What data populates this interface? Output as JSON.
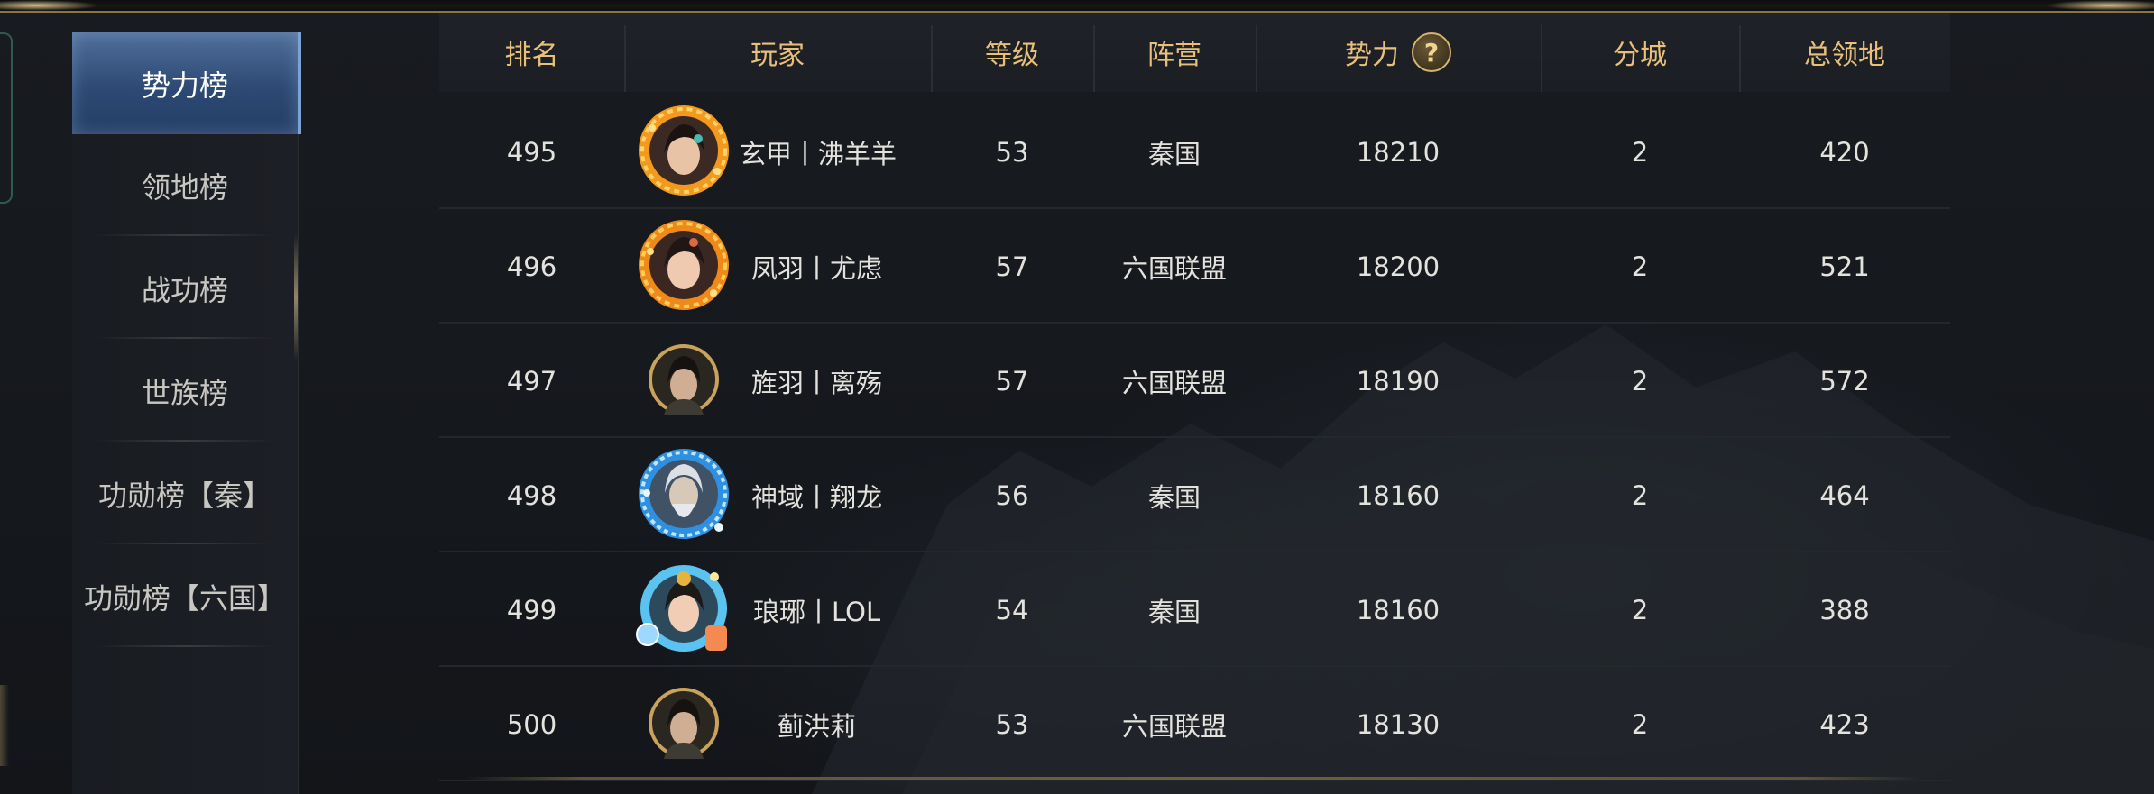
{
  "sidebar": {
    "items": [
      {
        "label": "势力榜",
        "active": true
      },
      {
        "label": "领地榜",
        "active": false
      },
      {
        "label": "战功榜",
        "active": false
      },
      {
        "label": "世族榜",
        "active": false
      },
      {
        "label": "功勋榜【秦】",
        "active": false
      },
      {
        "label": "功勋榜【六国】",
        "active": false
      }
    ]
  },
  "table": {
    "headers": {
      "rank": "排名",
      "player": "玩家",
      "level": "等级",
      "faction": "阵营",
      "power": "势力",
      "help_glyph": "?",
      "cities": "分城",
      "territory": "总领地"
    },
    "rows": [
      {
        "rank": "495",
        "player": "玄甲丨沸羊羊",
        "level": "53",
        "faction": "秦国",
        "power": "18210",
        "cities": "2",
        "territory": "420",
        "avatar": "female-avatar-fire-frame"
      },
      {
        "rank": "496",
        "player": "凤羽丨尤虑",
        "level": "57",
        "faction": "六国联盟",
        "power": "18200",
        "cities": "2",
        "territory": "521",
        "avatar": "female-avatar-fire-frame"
      },
      {
        "rank": "497",
        "player": "旌羽丨离殇",
        "level": "57",
        "faction": "六国联盟",
        "power": "18190",
        "cities": "2",
        "territory": "572",
        "avatar": "male-avatar-plain-frame"
      },
      {
        "rank": "498",
        "player": "神域丨翔龙",
        "level": "56",
        "faction": "秦国",
        "power": "18160",
        "cities": "2",
        "territory": "464",
        "avatar": "elder-avatar-ice-frame"
      },
      {
        "rank": "499",
        "player": "琅琊丨LOL",
        "level": "54",
        "faction": "秦国",
        "power": "18160",
        "cities": "2",
        "territory": "388",
        "avatar": "female-avatar-festive-frame"
      },
      {
        "rank": "500",
        "player": "蓟洪莉",
        "level": "53",
        "faction": "六国联盟",
        "power": "18130",
        "cities": "2",
        "territory": "423",
        "avatar": "male-avatar-plain-frame"
      }
    ]
  },
  "colors": {
    "header_text": "#e8c07a",
    "active_tab": "#2d4a75",
    "body_text": "#e4e2dc"
  }
}
